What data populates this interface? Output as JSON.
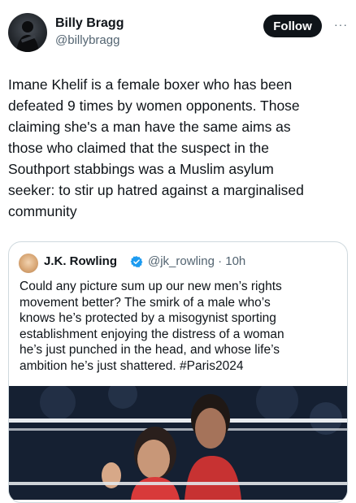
{
  "author": {
    "name": "Billy Bragg",
    "handle": "@billybragg",
    "follow_label": "Follow",
    "more_label": "···"
  },
  "tweet": {
    "lines": [
      "Imane Khelif is a female boxer who has been",
      "defeated 9 times by women opponents. Those",
      "claiming she's a man have the same aims as",
      "those who claimed that the suspect in the",
      "Southport stabbings was a Muslim asylum",
      "seeker: to stir up hatred against a marginalised",
      "community"
    ]
  },
  "quoted": {
    "name": "J.K. Rowling",
    "handle_time": "@jk_rowling · 10h",
    "lines": [
      "Could any picture sum up our new men’s rights",
      "movement better? The smirk of a male who’s",
      "knows he’s protected by a misogynist sporting",
      "establishment enjoying the distress of a woman",
      "he’s just punched in the head, and whose life’s",
      "ambition he’s just shattered. #Paris2024"
    ]
  },
  "icons": {
    "verified": "verified-badge-icon",
    "more": "more-icon"
  },
  "colors": {
    "text": "#0f1419",
    "secondary": "#536471",
    "follow_bg": "#0f1419",
    "verified": "#1d9bf0",
    "border": "#cfd9de"
  }
}
